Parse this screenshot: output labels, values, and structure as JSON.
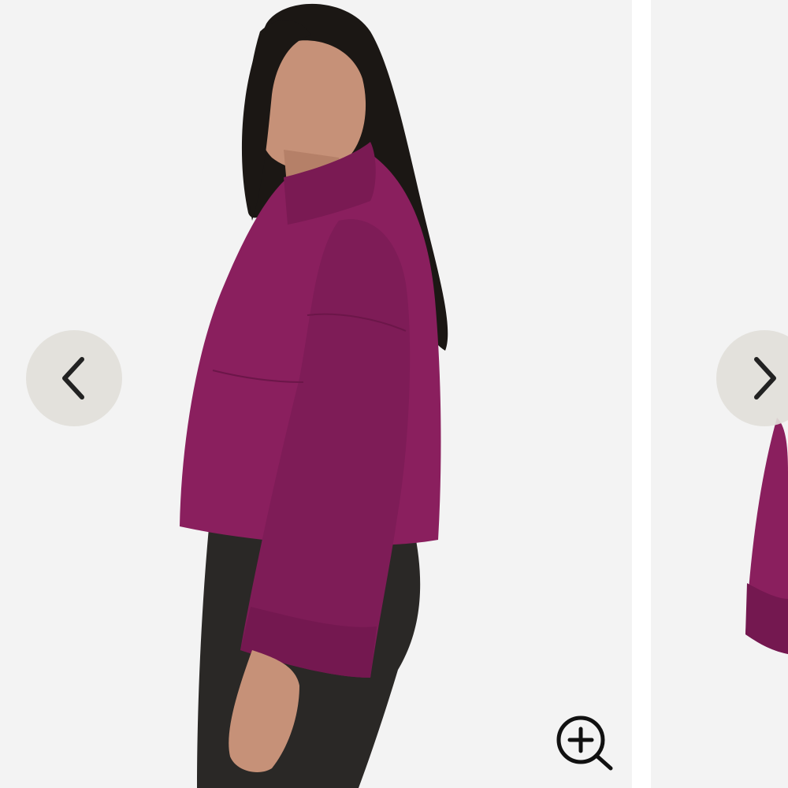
{
  "gallery": {
    "current_image": {
      "alt": "",
      "product_color": "#8a1f5e"
    },
    "controls": {
      "prev_icon": "chevron-left-icon",
      "next_icon": "chevron-right-icon",
      "zoom_icon": "zoom-in-icon"
    },
    "colors": {
      "backdrop": "#f3f3f3",
      "nav_button": "#e2e0da",
      "icon": "#222222"
    }
  }
}
